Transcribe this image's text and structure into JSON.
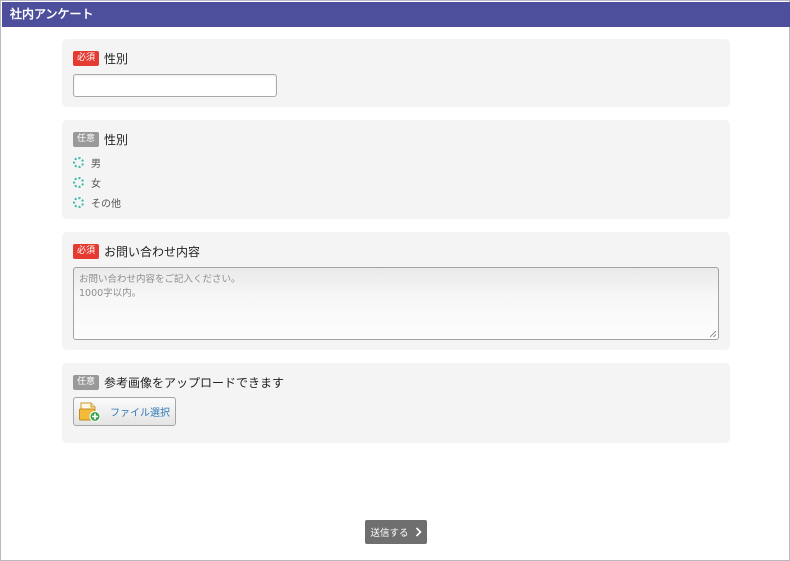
{
  "window": {
    "title": "社内アンケート"
  },
  "questions": {
    "q1": {
      "badge": "必須",
      "label": "性別"
    },
    "q2": {
      "badge": "任意",
      "label": "性別",
      "options": [
        "男",
        "女",
        "その他"
      ]
    },
    "q3": {
      "badge": "必須",
      "label": "お問い合わせ内容",
      "placeholder_line1": "お問い合わせ内容をご記入ください。",
      "placeholder_line2": "1000字以内。"
    },
    "q4": {
      "badge": "任意",
      "label": "参考画像をアップロードできます",
      "file_button": "ファイル選択"
    }
  },
  "submit": {
    "label": "送信する",
    "icon": "chevron-right-icon"
  },
  "icons": {
    "radio": "radio-unchecked-icon",
    "file": "file-add-icon"
  },
  "colors": {
    "title_bar": "#4e4f9c",
    "required_badge": "#e53a32",
    "optional_badge": "#999999",
    "radio_accent": "#3fb8a6",
    "submit_button": "#6f6f6f",
    "file_label": "#2f78b8"
  }
}
